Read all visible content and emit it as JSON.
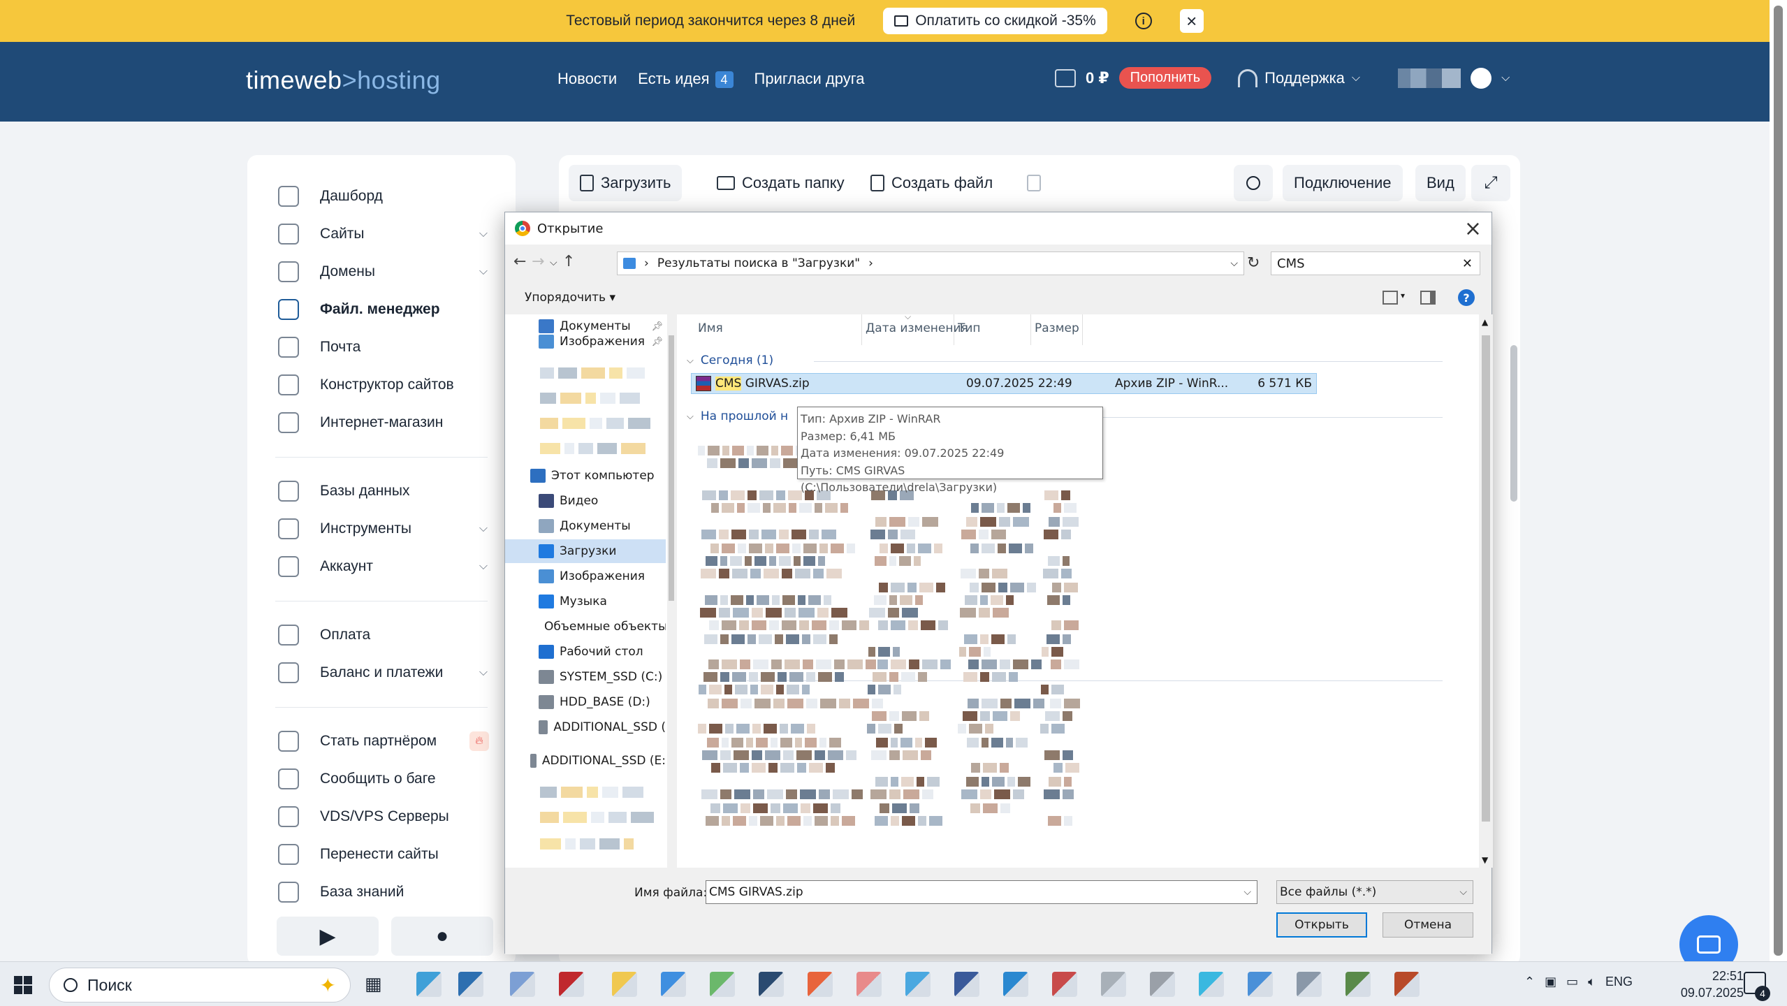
{
  "banner": {
    "text": "Тестовый период закончится через 8 дней",
    "pay_label": "Оплатить со скидкой -35%"
  },
  "header": {
    "logo_main": "timeweb",
    "logo_sep": ">",
    "logo_sub": "hosting",
    "nav": [
      {
        "label": "Новости"
      },
      {
        "label": "Есть идея",
        "badge": "4"
      },
      {
        "label": "Пригласи друга"
      }
    ],
    "balance": "0 ₽",
    "topup_label": "Пополнить",
    "support_label": "Поддержка"
  },
  "sidebar": {
    "items": [
      {
        "label": "Дашборд",
        "icon": "dashboard-icon"
      },
      {
        "label": "Сайты",
        "icon": "monitor-icon",
        "chevron": true
      },
      {
        "label": "Домены",
        "icon": "globe-icon",
        "chevron": true
      },
      {
        "label": "Файл. менеджер",
        "icon": "folder-icon",
        "active": true
      },
      {
        "label": "Почта",
        "icon": "mail-icon"
      },
      {
        "label": "Конструктор сайтов",
        "icon": "builder-icon"
      },
      {
        "label": "Интернет-магазин",
        "icon": "store-icon"
      },
      {
        "label": "Базы данных",
        "icon": "database-icon"
      },
      {
        "label": "Инструменты",
        "icon": "tools-icon",
        "chevron": true
      },
      {
        "label": "Аккаунт",
        "icon": "gear-icon",
        "chevron": true
      },
      {
        "label": "Оплата",
        "icon": "card-icon"
      },
      {
        "label": "Баланс и платежи",
        "icon": "receipt-icon",
        "chevron": true
      },
      {
        "label": "Стать партнёром",
        "icon": "partner-icon",
        "fire": true
      },
      {
        "label": "Сообщить о баге",
        "icon": "bug-icon"
      },
      {
        "label": "VDS/VPS Серверы",
        "icon": "cloud-icon"
      },
      {
        "label": "Перенести сайты",
        "icon": "transfer-icon"
      },
      {
        "label": "База знаний",
        "icon": "help-icon"
      }
    ]
  },
  "file_manager": {
    "upload_label": "Загрузить",
    "new_folder_label": "Создать папку",
    "new_file_label": "Создать файл",
    "connect_label": "Подключение",
    "view_label": "Вид"
  },
  "dialog": {
    "title": "Открытие",
    "address": "Результаты поиска в \"Загрузки\"",
    "search_value": "CMS",
    "organize_label": "Упорядочить",
    "nav_items": [
      {
        "label": "Документы",
        "pin": true
      },
      {
        "label": "Изображения",
        "pin": true
      },
      {
        "label": "Этот компьютер"
      },
      {
        "label": "Видео"
      },
      {
        "label": "Документы"
      },
      {
        "label": "Загрузки",
        "selected": true
      },
      {
        "label": "Изображения"
      },
      {
        "label": "Музыка"
      },
      {
        "label": "Объемные объекты"
      },
      {
        "label": "Рабочий стол"
      },
      {
        "label": "SYSTEM_SSD (C:)"
      },
      {
        "label": "HDD_BASE (D:)"
      },
      {
        "label": "ADDITIONAL_SSD ("
      },
      {
        "label": "ADDITIONAL_SSD (E:"
      }
    ],
    "columns": {
      "name": "Имя",
      "date": "Дата изменения",
      "type": "Тип",
      "size": "Размер"
    },
    "group_today": "Сегодня (1)",
    "group_lastweek": "На прошлой н",
    "file": {
      "name_hl": "CMS",
      "name_rest": " GIRVAS.zip",
      "date": "09.07.2025 22:49",
      "type": "Архив ZIP - WinR...",
      "size": "6 571 КБ"
    },
    "tooltip": {
      "type": "Тип: Архив ZIP - WinRAR",
      "size": "Размер: 6,41 МБ",
      "date": "Дата изменения: 09.07.2025 22:49",
      "path": "Путь: CMS GIRVAS (C:\\Пользователи\\drela\\Загрузки)"
    },
    "filename_label": "Имя файла:",
    "filename_value": "CMS GIRVAS.zip",
    "filetype_value": "Все файлы (*.*)",
    "open_label": "Открыть",
    "cancel_label": "Отмена"
  },
  "taskbar": {
    "search_placeholder": "Поиск",
    "lang": "ENG",
    "time": "22:51",
    "date": "09.07.2025",
    "notif_count": "4"
  }
}
